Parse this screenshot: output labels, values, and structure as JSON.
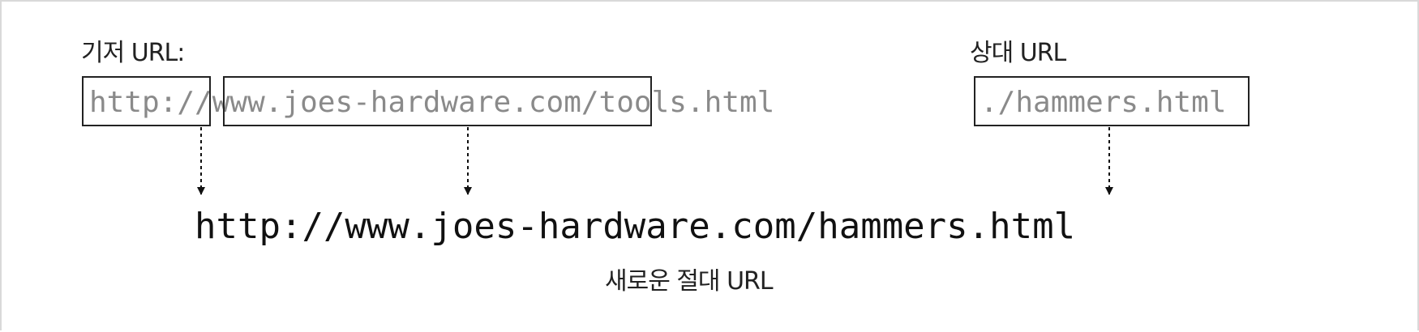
{
  "labels": {
    "base_url": "기저 URL:",
    "relative_url": "상대 URL",
    "new_absolute_url": "새로운 절대 URL"
  },
  "base_url": {
    "scheme_part": "http:/",
    "host_part": "/www.joes-hardware.com/",
    "path_part": "tools.html"
  },
  "relative_url": "./hammers.html",
  "result_url": "http://www.joes-hardware.com/hammers.html"
}
